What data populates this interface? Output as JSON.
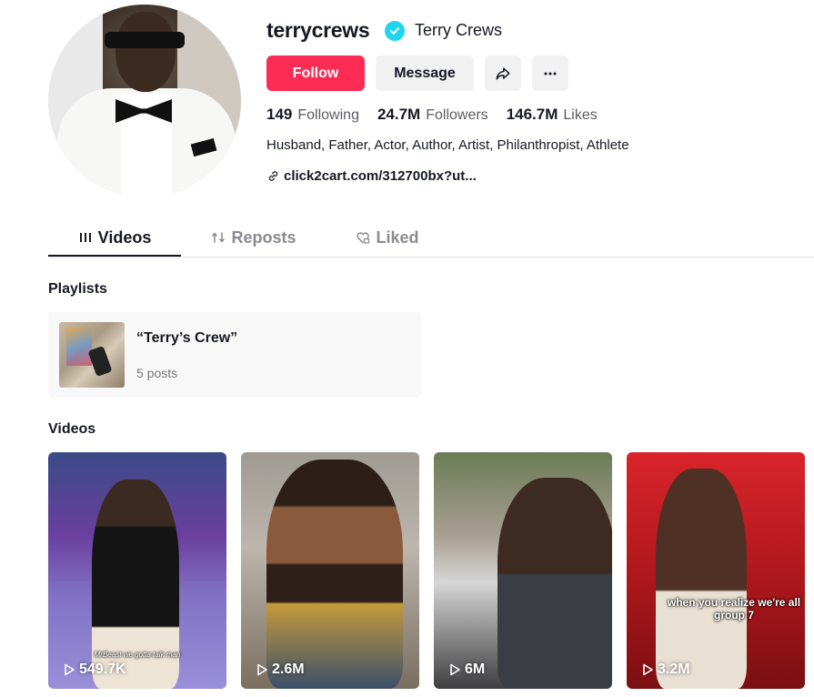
{
  "profile": {
    "username": "terrycrews",
    "nickname": "Terry Crews",
    "verified": true,
    "follow_label": "Follow",
    "message_label": "Message",
    "stats": [
      {
        "value": "149",
        "label": "Following"
      },
      {
        "value": "24.7M",
        "label": "Followers"
      },
      {
        "value": "146.7M",
        "label": "Likes"
      }
    ],
    "bio": "Husband, Father, Actor, Author, Artist, Philanthropist, Athlete",
    "link": "click2cart.com/312700bx?ut..."
  },
  "tabs": [
    {
      "label": "Videos",
      "icon": "grid-icon",
      "active": true
    },
    {
      "label": "Reposts",
      "icon": "repost-icon",
      "active": false
    },
    {
      "label": "Liked",
      "icon": "heart-lock-icon",
      "active": false
    }
  ],
  "playlists_title": "Playlists",
  "playlist": {
    "name": "“Terry’s Crew”",
    "count": "5 posts"
  },
  "videos_title": "Videos",
  "videos": [
    {
      "views": "549.7K",
      "caption": "MrBeast we gotta talk man"
    },
    {
      "views": "2.6M",
      "caption": ""
    },
    {
      "views": "6M",
      "caption": ""
    },
    {
      "views": "3.2M",
      "caption": "when you realize we're all group 7"
    }
  ],
  "colors": {
    "accent": "#fe2c55",
    "verified": "#20d5ec",
    "text": "#161823",
    "muted": "#5a5c63"
  }
}
